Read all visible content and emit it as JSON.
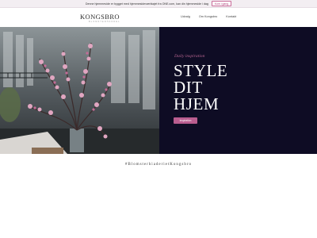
{
  "topbar": {
    "text": "Denne hjemmeside er bygget med hjemmesidevœrktøjet fra ONE.com, kan din hjemmeside i dag",
    "button_label": "Kom i gang"
  },
  "header": {
    "logo": "KONGSBRO",
    "logo_sub": "BLOMSTERHANDEL",
    "nav": [
      "Udvalg",
      "Om Kongsbro",
      "Kontakt"
    ]
  },
  "hero": {
    "tagline": "Daily inspiration",
    "headline_lines": [
      "STYLE",
      "DIT",
      "HJEM"
    ],
    "button_label": "Inspiration"
  },
  "hashtag": "#BlomsterhiaderietKongsbro",
  "colors": {
    "accent": "#b95d8f",
    "panel": "#0e0c24",
    "topbar": "#f3eef2"
  }
}
